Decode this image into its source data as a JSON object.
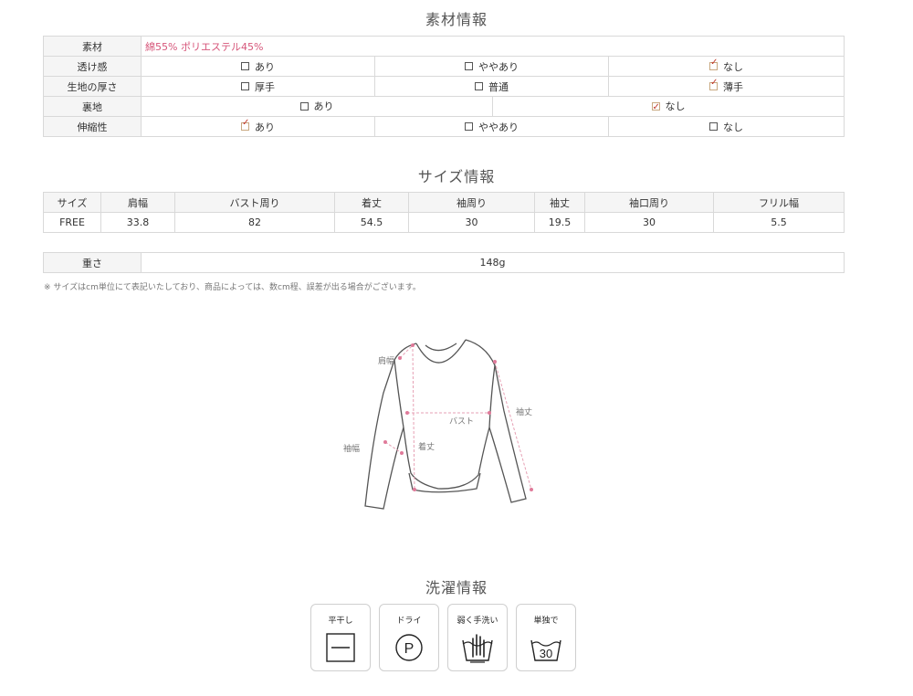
{
  "material_section": {
    "title": "素材情報",
    "rows": [
      {
        "label": "素材",
        "value": "綿55% ポリエステル45%"
      },
      {
        "label": "透け感",
        "options": [
          {
            "text": "あり",
            "checked": false
          },
          {
            "text": "ややあり",
            "checked": false
          },
          {
            "text": "なし",
            "checked": true
          }
        ]
      },
      {
        "label": "生地の厚さ",
        "options": [
          {
            "text": "厚手",
            "checked": false
          },
          {
            "text": "普通",
            "checked": false
          },
          {
            "text": "薄手",
            "checked": true
          }
        ]
      },
      {
        "label": "裏地",
        "options": [
          {
            "text": "あり",
            "checked": false
          },
          {
            "text": "なし",
            "checked": true
          }
        ]
      },
      {
        "label": "伸縮性",
        "options": [
          {
            "text": "あり",
            "checked": true
          },
          {
            "text": "ややあり",
            "checked": false
          },
          {
            "text": "なし",
            "checked": false
          }
        ]
      }
    ]
  },
  "size_section": {
    "title": "サイズ情報",
    "headers": [
      "サイズ",
      "肩幅",
      "バスト周り",
      "着丈",
      "袖周り",
      "袖丈",
      "袖口周り",
      "フリル幅"
    ],
    "row": [
      "FREE",
      "33.8",
      "82",
      "54.5",
      "30",
      "19.5",
      "30",
      "5.5"
    ],
    "weight_label": "重さ",
    "weight_value": "148g",
    "note": "※ サイズはcm単位にて表記いたしており、商品によっては、数cm程、誤差が出る場合がございます。"
  },
  "diagram": {
    "labels": {
      "shoulder": "肩幅",
      "bust": "バスト",
      "length": "着丈",
      "sleeve_width": "袖幅",
      "sleeve_length": "袖丈"
    }
  },
  "care_section": {
    "title": "洗濯情報",
    "items": [
      {
        "label": "平干し",
        "icon": "flat-dry-icon"
      },
      {
        "label": "ドライ",
        "icon": "dry-clean-p-icon",
        "symbol": "P"
      },
      {
        "label": "弱く手洗い",
        "icon": "hand-wash-icon"
      },
      {
        "label": "単独で",
        "icon": "wash-30-icon",
        "symbol": "30"
      }
    ]
  }
}
